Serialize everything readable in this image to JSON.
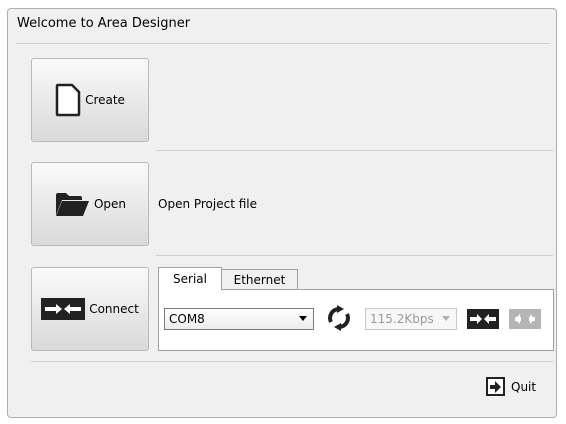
{
  "window": {
    "title": "Welcome to Area Designer"
  },
  "create": {
    "label": "Create"
  },
  "open": {
    "label": "Open",
    "hint": "Open Project file"
  },
  "connect": {
    "label": "Connect"
  },
  "tabs": [
    {
      "label": "Serial",
      "active": true
    },
    {
      "label": "Ethernet",
      "active": false
    }
  ],
  "serial": {
    "port": "COM8",
    "baud": "115.2Kbps",
    "baud_enabled": false
  },
  "icons": {
    "create": "document-icon",
    "open": "folder-icon",
    "connect": "plug-connect-icon",
    "refresh": "refresh-icon",
    "connect_small": "connect-icon",
    "disconnect_small": "disconnect-icon",
    "quit": "exit-icon"
  },
  "quit": {
    "label": "Quit"
  },
  "colors": {
    "icon_dark": "#222222",
    "icon_disabled": "#b5b5b5",
    "separator": "#cfcfcf"
  }
}
